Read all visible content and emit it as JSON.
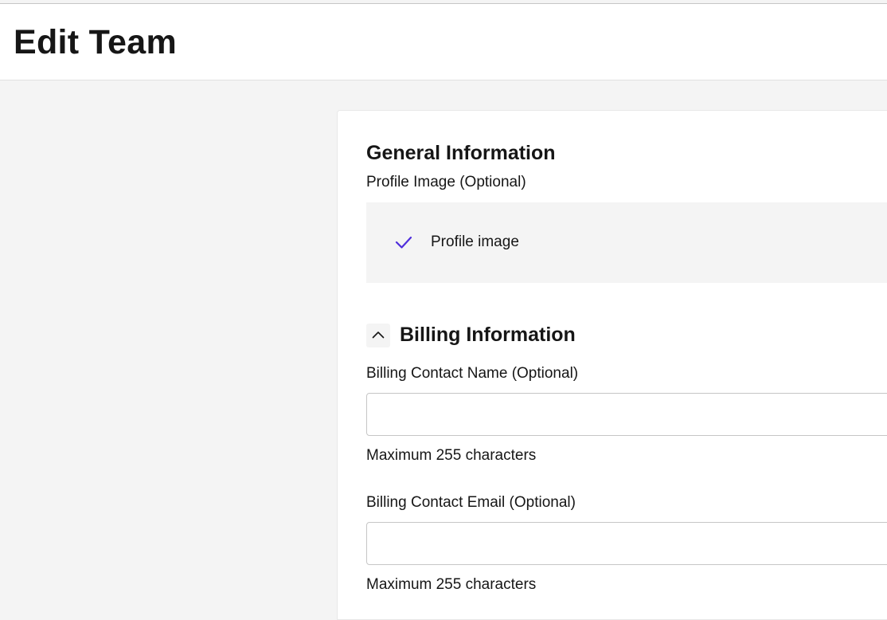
{
  "header": {
    "title": "Edit Team"
  },
  "general": {
    "title": "General Information",
    "profile_image_label": "Profile Image (Optional)",
    "profile_image_item": "Profile image",
    "profile_image_icon": "checkmark-icon"
  },
  "billing": {
    "title": "Billing Information",
    "collapse_icon": "chevron-up-icon",
    "contact_name": {
      "label": "Billing Contact Name (Optional)",
      "value": "",
      "helper": "Maximum 255 characters"
    },
    "contact_email": {
      "label": "Billing Contact Email (Optional)",
      "value": "",
      "helper": "Maximum 255 characters"
    }
  },
  "colors": {
    "accent": "#4f2edc",
    "page_background": "#f4f4f4",
    "surface": "#ffffff"
  }
}
